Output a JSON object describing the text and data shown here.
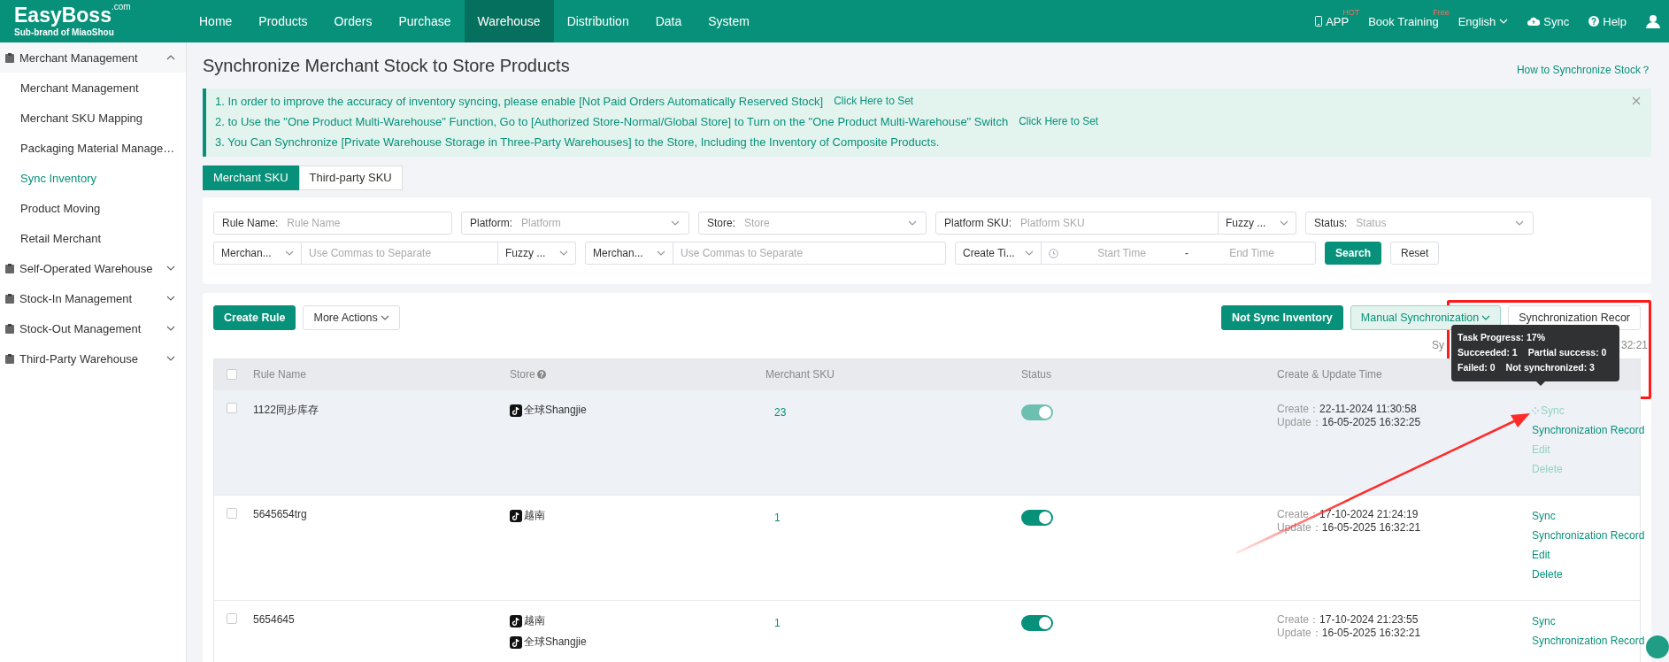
{
  "topbar": {
    "logo": {
      "name": "EasyBoss",
      "suffix": ".com",
      "subtitle": "Sub-brand of MiaoShou"
    },
    "nav": [
      {
        "label": "Home",
        "selected": false
      },
      {
        "label": "Products",
        "selected": false
      },
      {
        "label": "Orders",
        "selected": false
      },
      {
        "label": "Purchase",
        "selected": false
      },
      {
        "label": "Warehouse",
        "selected": true
      },
      {
        "label": "Distribution",
        "selected": false
      },
      {
        "label": "Data",
        "selected": false
      },
      {
        "label": "System",
        "selected": false
      }
    ],
    "right": [
      {
        "kind": "app",
        "label": "APP",
        "badge": "HOT"
      },
      {
        "kind": "training",
        "label": "Book Training",
        "badge": "Free"
      },
      {
        "kind": "language",
        "label": "English"
      },
      {
        "kind": "sync",
        "label": "Sync"
      },
      {
        "kind": "help",
        "label": "Help"
      },
      {
        "kind": "user"
      }
    ]
  },
  "sidebar": [
    {
      "label": "Merchant Management",
      "expanded": true,
      "children": [
        {
          "label": "Merchant Management",
          "selected": false
        },
        {
          "label": "Merchant SKU Mapping",
          "selected": false
        },
        {
          "label": "Packaging Material Manage…",
          "selected": false
        },
        {
          "label": "Sync Inventory",
          "selected": true
        },
        {
          "label": "Product Moving",
          "selected": false
        },
        {
          "label": "Retail Merchant",
          "selected": false
        }
      ]
    },
    {
      "label": "Self-Operated Warehouse",
      "expanded": false
    },
    {
      "label": "Stock-In Management",
      "expanded": false
    },
    {
      "label": "Stock-Out Management",
      "expanded": false
    },
    {
      "label": "Third-Party Warehouse",
      "expanded": false
    }
  ],
  "page": {
    "title": "Synchronize Merchant Stock to Store Products",
    "help_link": "How to Synchronize Stock？",
    "notice": [
      {
        "text": "1. In order to improve the accuracy of inventory syncing, please enable [Not Paid Orders Automatically Reserved Stock]",
        "link": "Click Here to Set"
      },
      {
        "text": "2. to Use the \"One Product Multi-Warehouse\" Function, Go to [Authorized Store-Normal/Global Store] to Turn on the \"One Product Multi-Warehouse\" Switch",
        "link": "Click Here to Set"
      },
      {
        "text": "3. You Can Synchronize [Private Warehouse Storage in Three-Party Warehouses] to the Store, Including the Inventory of Composite Products."
      }
    ],
    "tabs": [
      {
        "label": "Merchant SKU",
        "selected": true
      },
      {
        "label": "Third-party SKU",
        "selected": false
      }
    ],
    "filters": [
      [
        {
          "kind": "input",
          "label": "Rule Name:",
          "placeholder": "Rule Name"
        },
        {
          "kind": "select",
          "label": "Platform:",
          "placeholder": "Platform"
        },
        {
          "kind": "select",
          "label": "Store:",
          "placeholder": "Store"
        },
        {
          "kind": "input-fuzzy",
          "label": "Platform SKU:",
          "placeholder": "Platform SKU",
          "mode": "Fuzzy ..."
        },
        {
          "kind": "select",
          "label": "Status:",
          "placeholder": "Status"
        }
      ],
      [
        {
          "kind": "prefix-fuzzy",
          "prefix": "Merchan...",
          "placeholder": "Use Commas to Separate",
          "mode": "Fuzzy ..."
        },
        {
          "kind": "prefix",
          "prefix": "Merchan...",
          "placeholder": "Use Commas to Separate"
        },
        {
          "kind": "daterange",
          "prefix": "Create Ti...",
          "start": {
            "placeholder": "Start Time"
          },
          "separator": "-",
          "end": {
            "placeholder": "End Time"
          }
        },
        {
          "kind": "submit",
          "label": "Search"
        },
        {
          "kind": "reset",
          "label": "Reset"
        }
      ]
    ],
    "toolbar": {
      "left": [
        {
          "kind": "create",
          "label": "Create Rule"
        },
        {
          "kind": "menu",
          "label": "More Actions"
        }
      ],
      "right": [
        {
          "kind": "create",
          "label": "Not Sync Inventory"
        },
        {
          "kind": "sync-menu",
          "label": "Manual Synchronization"
        },
        {
          "kind": "record",
          "label": "Synchronization Recor"
        }
      ],
      "sync_time_fragments": [
        "Sy",
        "32:21"
      ]
    },
    "tooltip": {
      "title": "Task Progress: 17%",
      "rows": [
        [
          "Succeeded: 1",
          "Partial success: 0"
        ],
        [
          "Failed: 0",
          "Not synchronized: 3"
        ]
      ]
    },
    "table": {
      "columns": [
        "Rule Name",
        "Store",
        "Merchant SKU",
        "Status",
        "Create & Update Time"
      ],
      "header_checked": false,
      "rows": [
        {
          "checked": false,
          "highlighted": true,
          "rule_name": "1122同步库存",
          "stores": [
            "全球Shangjie"
          ],
          "sku": "23",
          "status": {
            "on": true,
            "disabled": true
          },
          "create_label": "Create：",
          "create": "22-11-2024 11:30:58",
          "update_label": "Update：",
          "update": "16-05-2025 16:32:25",
          "actions": [
            {
              "label": "Sync",
              "disabled": true,
              "loading": true
            },
            {
              "label": "Synchronization Record",
              "disabled": false,
              "loading": false
            },
            {
              "label": "Edit",
              "disabled": true,
              "loading": false
            },
            {
              "label": "Delete",
              "disabled": true,
              "loading": false
            }
          ]
        },
        {
          "checked": false,
          "highlighted": false,
          "rule_name": "5645654trg",
          "stores": [
            "越南"
          ],
          "sku": "1",
          "status": {
            "on": true,
            "disabled": false
          },
          "create_label": "Create：",
          "create": "17-10-2024 21:24:19",
          "update_label": "Update：",
          "update": "16-05-2025 16:32:21",
          "actions": [
            {
              "label": "Sync",
              "disabled": false,
              "loading": false
            },
            {
              "label": "Synchronization Record",
              "disabled": false,
              "loading": false
            },
            {
              "label": "Edit",
              "disabled": false,
              "loading": false
            },
            {
              "label": "Delete",
              "disabled": false,
              "loading": false
            }
          ]
        },
        {
          "checked": false,
          "highlighted": false,
          "rule_name": "5654645",
          "stores": [
            "越南",
            "全球Shangjie"
          ],
          "sku": "1",
          "status": {
            "on": true,
            "disabled": false
          },
          "create_label": "Create：",
          "create": "17-10-2024 21:23:55",
          "update_label": "Update：",
          "update": "16-05-2025 16:32:21",
          "actions": [
            {
              "label": "Sync",
              "disabled": false,
              "loading": false
            },
            {
              "label": "Synchronization Record",
              "disabled": false,
              "loading": false
            }
          ]
        }
      ]
    }
  }
}
